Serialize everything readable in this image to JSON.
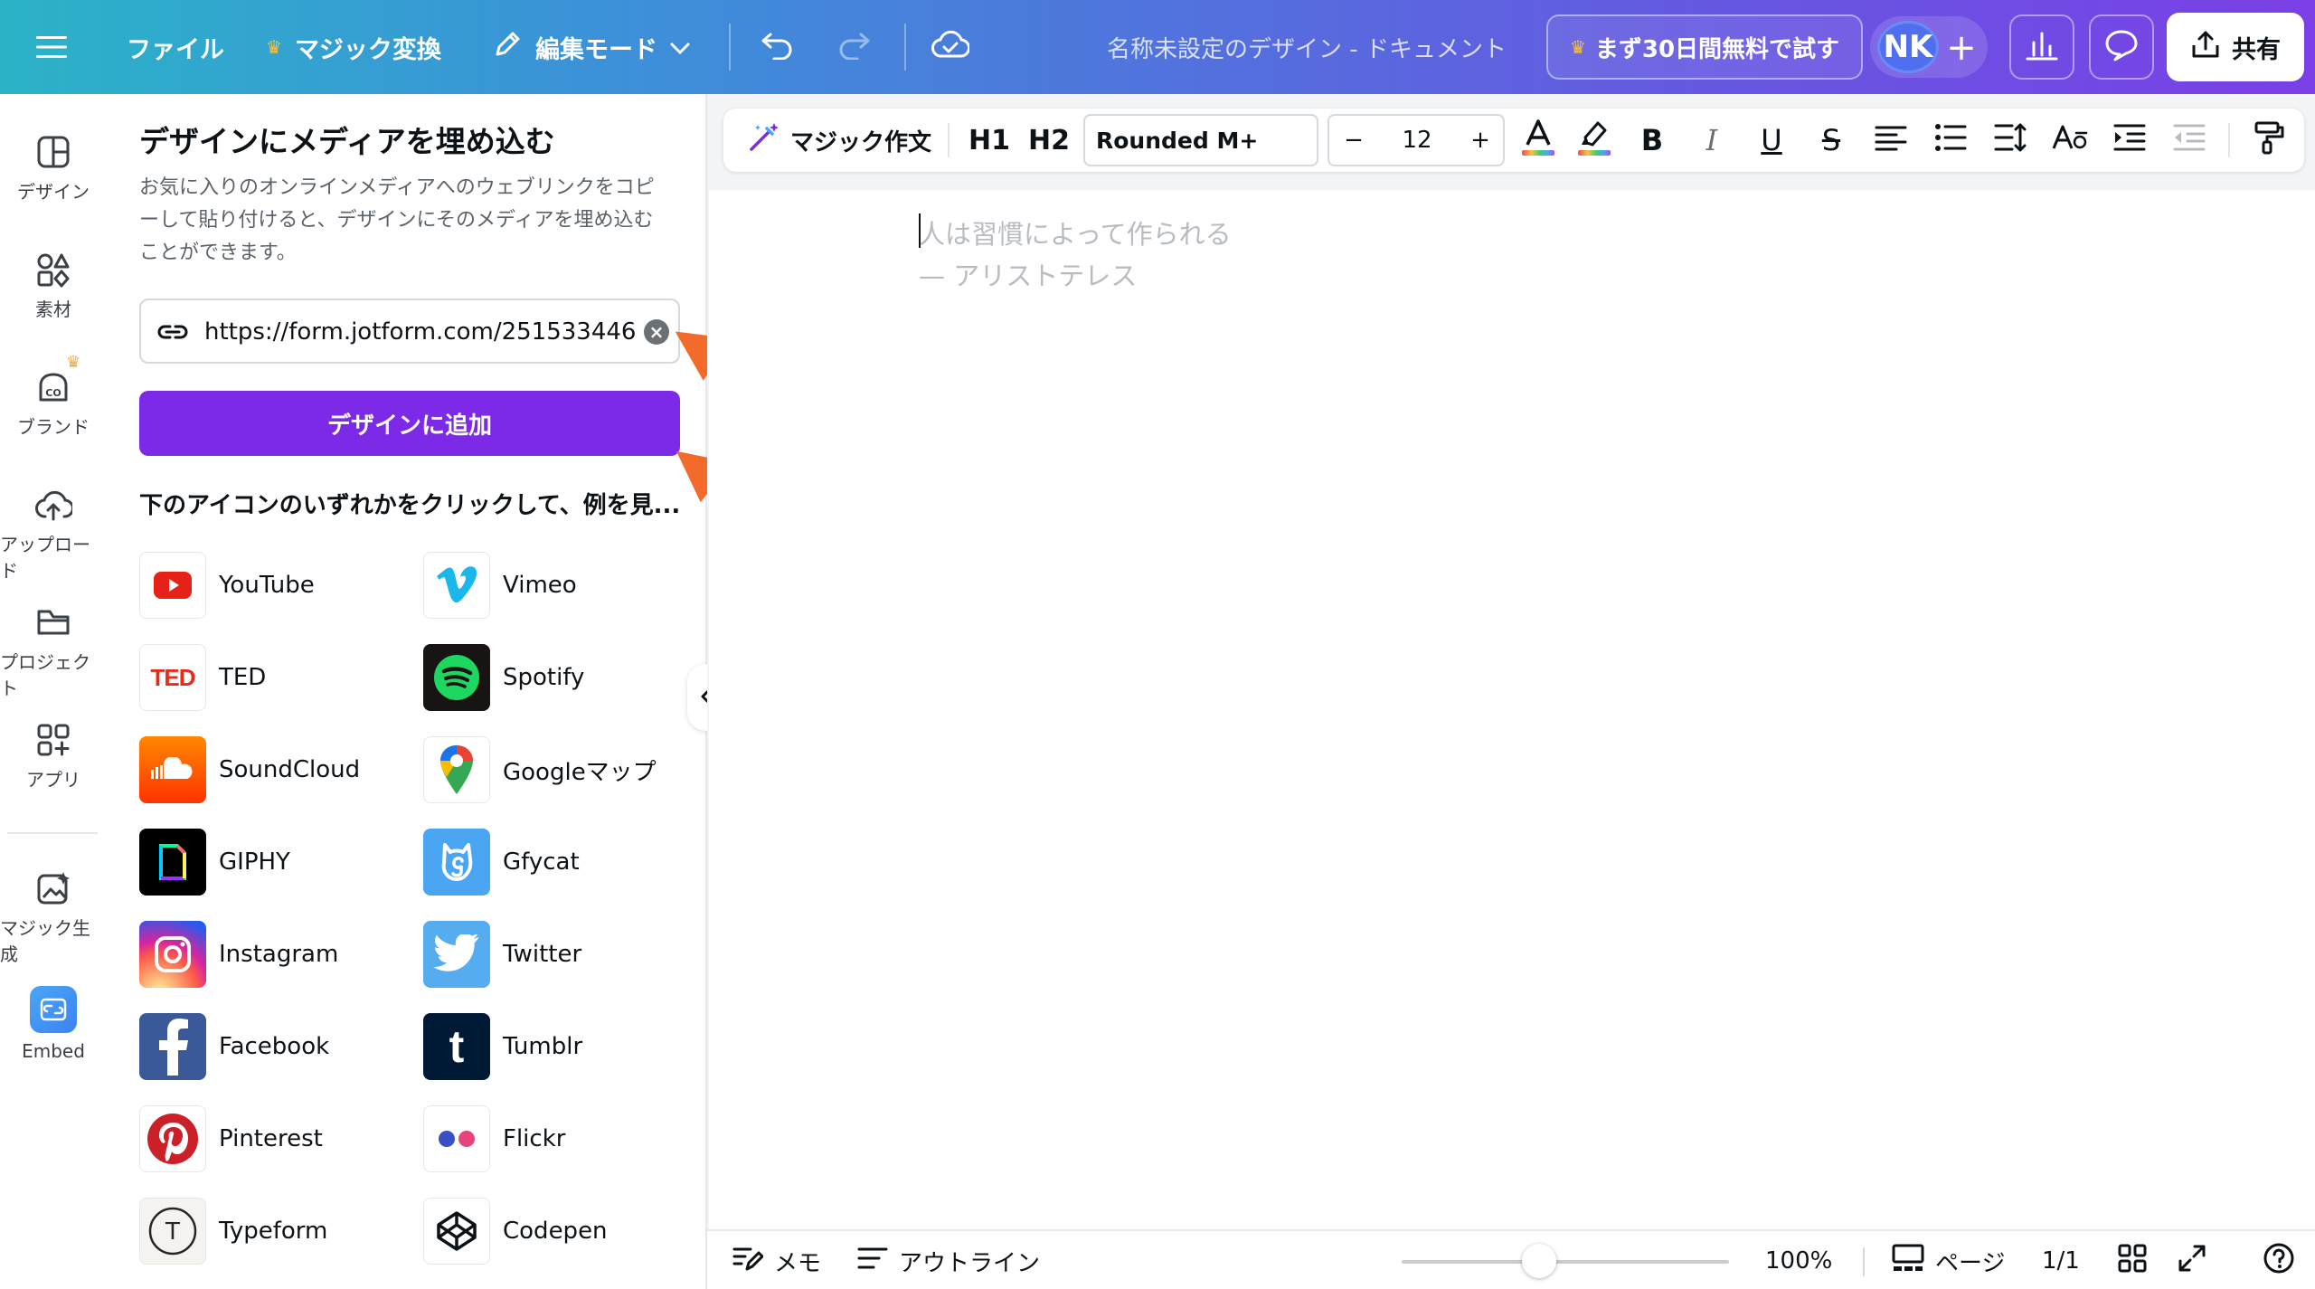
{
  "topbar": {
    "file_label": "ファイル",
    "magic_switch_label": "マジック変換",
    "edit_mode_label": "編集モード",
    "doc_title": "名称未設定のデザイン - ドキュメント",
    "trial_label": "まず30日間無料で試す",
    "avatar_initials": "NK",
    "share_label": "共有"
  },
  "rail": {
    "items": [
      {
        "label": "デザイン",
        "icon": "design-icon"
      },
      {
        "label": "素材",
        "icon": "elements-icon"
      },
      {
        "label": "ブランド",
        "icon": "brand-icon"
      },
      {
        "label": "アップロード",
        "icon": "upload-icon"
      },
      {
        "label": "プロジェクト",
        "icon": "folder-icon"
      },
      {
        "label": "アプリ",
        "icon": "apps-icon"
      },
      {
        "label": "マジック生成",
        "icon": "magic-media-icon"
      },
      {
        "label": "Embed",
        "icon": "embed-icon"
      }
    ]
  },
  "panel": {
    "title": "デザインにメディアを埋め込む",
    "description": "お気に入りのオンラインメディアへのウェブリンクをコピーして貼り付けると、デザインにそのメディアを埋め込むことができます。",
    "url_value": "https://form.jotform.com/251533446",
    "add_button": "デザインに追加",
    "hint": "下のアイコンのいずれかをクリックして、例を見...",
    "media": [
      {
        "name": "YouTube"
      },
      {
        "name": "Vimeo"
      },
      {
        "name": "TED"
      },
      {
        "name": "Spotify"
      },
      {
        "name": "SoundCloud"
      },
      {
        "name": "Googleマップ"
      },
      {
        "name": "GIPHY"
      },
      {
        "name": "Gfycat"
      },
      {
        "name": "Instagram"
      },
      {
        "name": "Twitter"
      },
      {
        "name": "Facebook"
      },
      {
        "name": "Tumblr"
      },
      {
        "name": "Pinterest"
      },
      {
        "name": "Flickr"
      },
      {
        "name": "Typeform"
      },
      {
        "name": "Codepen"
      }
    ]
  },
  "editor_toolbar": {
    "magic_write": "マジック作文",
    "h1": "H1",
    "h2": "H2",
    "font": "Rounded M+",
    "size_minus": "−",
    "font_size": "12",
    "size_plus": "+",
    "bold": "B",
    "italic": "I",
    "underline": "U",
    "strike": "S"
  },
  "canvas": {
    "quote_line1": "人は習慣によって作られる",
    "quote_line2": "— アリストテレス"
  },
  "footer": {
    "notes": "メモ",
    "outline": "アウトライン",
    "zoom": "100%",
    "zoom_level": 0.42,
    "pages": "ページ",
    "page_count": "1/1"
  },
  "colors": {
    "accent": "#7d2ae8",
    "arrow": "#f26b2a"
  }
}
